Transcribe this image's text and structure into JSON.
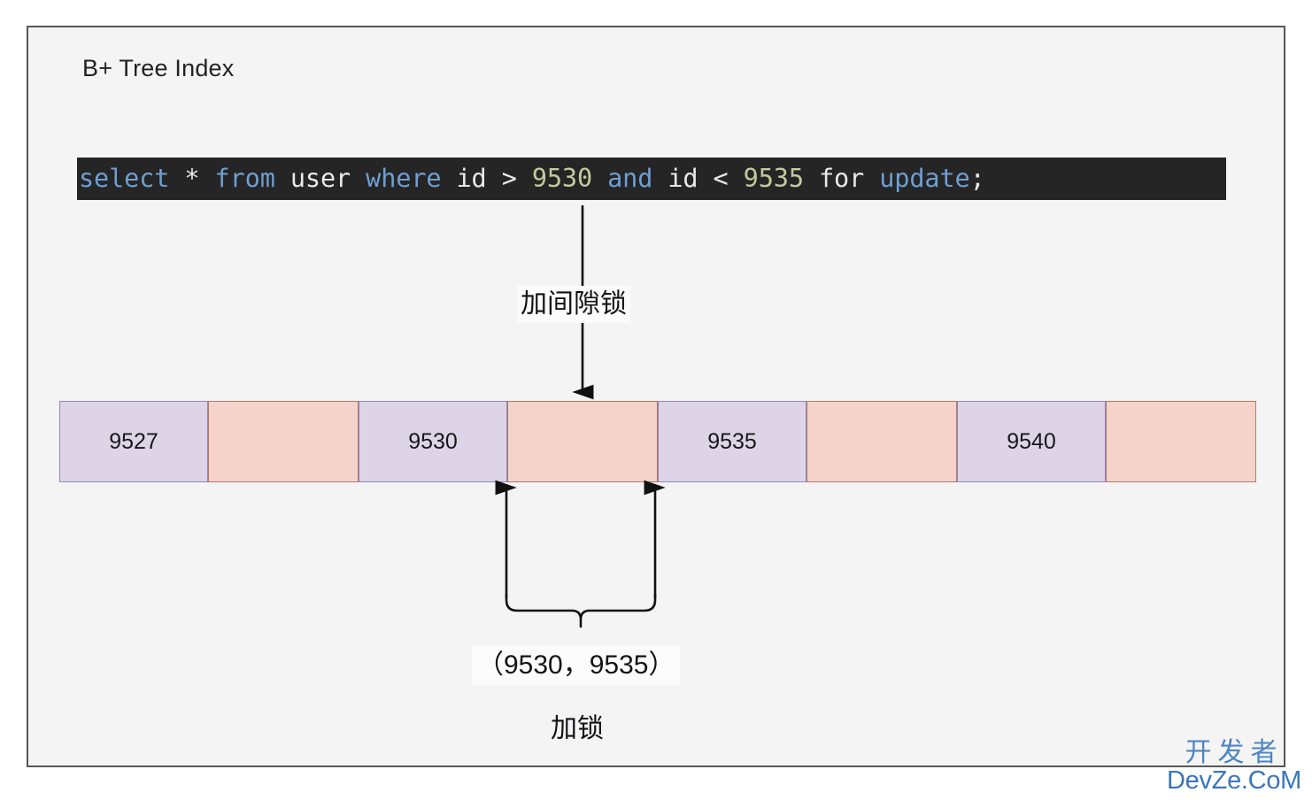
{
  "diagram": {
    "title": "B+ Tree Index",
    "frame_border_color": "#56565a",
    "background_color": "#f4f4f4"
  },
  "sql": {
    "background_color": "#252526",
    "tokens": [
      {
        "text": "select",
        "kind": "keyword"
      },
      {
        "text": " ",
        "kind": "plain"
      },
      {
        "text": "*",
        "kind": "operator"
      },
      {
        "text": " ",
        "kind": "plain"
      },
      {
        "text": "from",
        "kind": "keyword"
      },
      {
        "text": " ",
        "kind": "plain"
      },
      {
        "text": "user",
        "kind": "plain"
      },
      {
        "text": " ",
        "kind": "plain"
      },
      {
        "text": "where",
        "kind": "keyword"
      },
      {
        "text": " ",
        "kind": "plain"
      },
      {
        "text": "id",
        "kind": "plain"
      },
      {
        "text": " ",
        "kind": "plain"
      },
      {
        "text": ">",
        "kind": "operator"
      },
      {
        "text": " ",
        "kind": "plain"
      },
      {
        "text": "9530",
        "kind": "number"
      },
      {
        "text": " ",
        "kind": "plain"
      },
      {
        "text": "and",
        "kind": "keyword"
      },
      {
        "text": " ",
        "kind": "plain"
      },
      {
        "text": "id",
        "kind": "plain"
      },
      {
        "text": " ",
        "kind": "plain"
      },
      {
        "text": "<",
        "kind": "operator"
      },
      {
        "text": " ",
        "kind": "plain"
      },
      {
        "text": "9535",
        "kind": "number"
      },
      {
        "text": " ",
        "kind": "plain"
      },
      {
        "text": "for",
        "kind": "plain"
      },
      {
        "text": " ",
        "kind": "plain"
      },
      {
        "text": "update",
        "kind": "keyword"
      },
      {
        "text": ";",
        "kind": "plain"
      }
    ],
    "full_text": "select * from user where id > 9530 and id < 9535 for update;",
    "colors": {
      "keyword": "#6f9fd2",
      "plain": "#e9e9e9",
      "number": "#c2cb9c",
      "operator": "#e9e9e9"
    }
  },
  "index_row": {
    "key_fill": "#ddd4e8",
    "key_border": "#9287b4",
    "gap_fill": "#f5d3ca",
    "gap_border": "#ae7b71",
    "cells": [
      {
        "type": "key",
        "label": "9527"
      },
      {
        "type": "gap",
        "label": ""
      },
      {
        "type": "key",
        "label": "9530"
      },
      {
        "type": "gap",
        "label": "",
        "highlight": true
      },
      {
        "type": "key",
        "label": "9535"
      },
      {
        "type": "gap",
        "label": ""
      },
      {
        "type": "key",
        "label": "9540"
      },
      {
        "type": "gap",
        "label": ""
      }
    ]
  },
  "annotations": {
    "gap_lock_label": "加间隙锁",
    "range_label": "（9530，9535）",
    "lock_label": "加锁"
  },
  "watermark": {
    "cn": "开发者",
    "en": "DevZe.CoM",
    "color": "#3f7bbf"
  }
}
